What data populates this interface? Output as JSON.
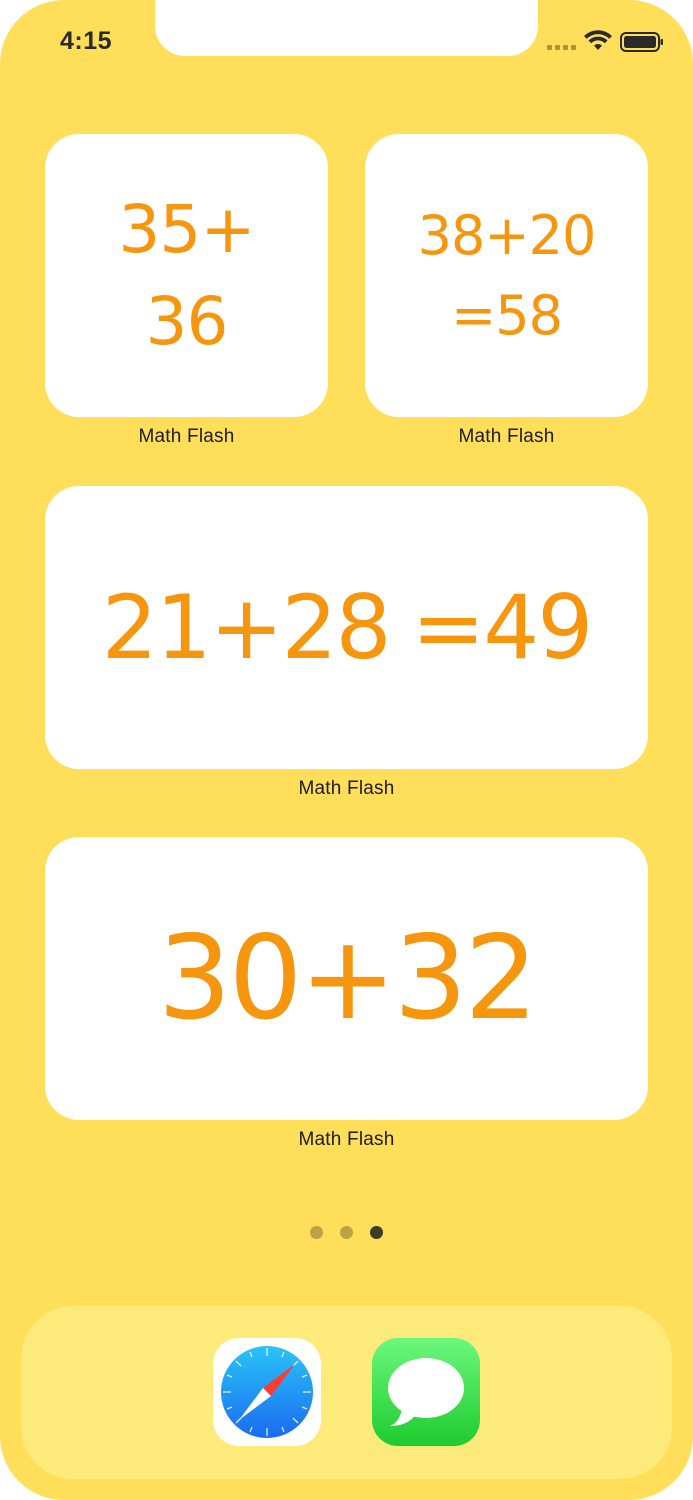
{
  "status_bar": {
    "time": "4:15"
  },
  "widgets": [
    {
      "line1": "35+",
      "line2": "36",
      "label": "Math Flash"
    },
    {
      "line1": "38+20",
      "line2": "=58",
      "label": "Math Flash"
    },
    {
      "left": "21+28",
      "right": "=49",
      "label": "Math Flash"
    },
    {
      "expression": "30+32",
      "label": "Math Flash"
    }
  ],
  "page_indicator": {
    "count": 3,
    "active_index": 2
  },
  "dock": {
    "apps": [
      {
        "name": "Safari",
        "icon": "safari-compass-icon"
      },
      {
        "name": "Messages",
        "icon": "speech-bubble-icon"
      }
    ]
  },
  "colors": {
    "background": "#FFDE5A",
    "accent": "#F6950E",
    "dock": "#FCEB7A"
  }
}
